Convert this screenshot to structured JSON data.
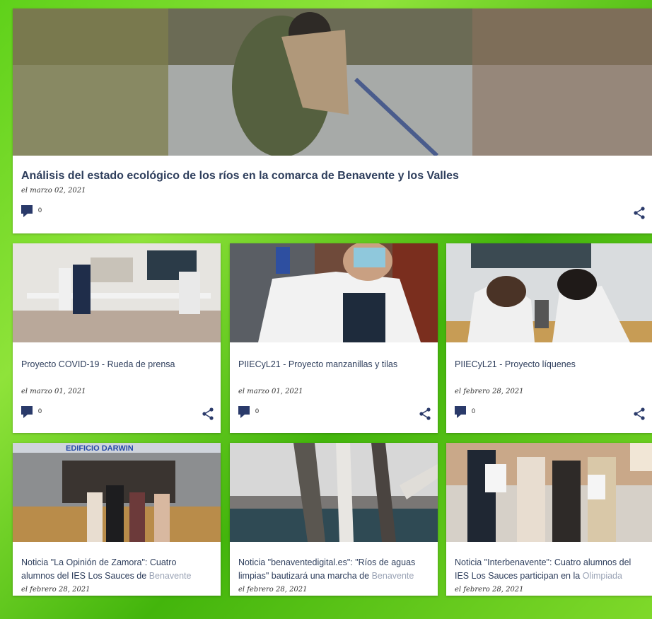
{
  "featured": {
    "title": "Análisis del estado ecológico de los ríos en la comarca de Benavente y los Valles",
    "date": "el marzo 02, 2021",
    "comments": "0"
  },
  "posts": [
    {
      "title": "Proyecto COVID-19 - Rueda de prensa",
      "date": "el marzo 01, 2021",
      "comments": "0"
    },
    {
      "title": "PIIECyL21 - Proyecto manzanillas y tilas",
      "date": "el marzo 01, 2021",
      "comments": "0"
    },
    {
      "title": "PIIECyL21 - Proyecto líquenes",
      "date": "el febrero 28, 2021",
      "comments": "0"
    },
    {
      "title_a": "Noticia \"La Opinión de Zamora\": Cuatro alumnos del IES Los Sauces de",
      "title_b": "Benavente",
      "date": "el febrero 28, 2021",
      "sign_text": "EDIFICIO DARWIN"
    },
    {
      "title_a": "Noticia \"benaventedigital.es\": \"Ríos de aguas limpias\" bautizará una marcha de",
      "title_b": "Benavente",
      "date": "el febrero 28, 2021"
    },
    {
      "title_a": "Noticia \"Interbenavente\": Cuatro alumnos del IES Los Sauces participan en la",
      "title_b": "Olimpiada",
      "date": "el febrero 28, 2021"
    }
  ],
  "icons": {
    "comment": "comment-icon",
    "share": "share-icon"
  },
  "colors": {
    "title": "#2e3e5c",
    "icon": "#2a3a6a",
    "background": "#5fd11a"
  }
}
